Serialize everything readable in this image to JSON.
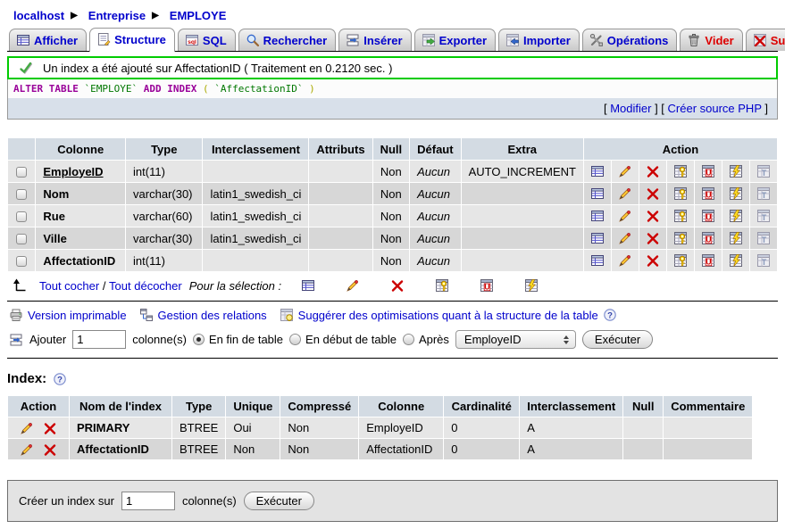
{
  "colors": {
    "link": "#0000CC",
    "danger": "#DD0000",
    "success_border": "#00CC00",
    "header_bg": "#D3DBE3",
    "row_odd": "#E6E6E6",
    "row_even": "#D7D7D7"
  },
  "breadcrumb": {
    "separator": "▶",
    "items": [
      {
        "label": "localhost",
        "icon": "server-icon"
      },
      {
        "label": "Entreprise",
        "icon": "database-icon"
      },
      {
        "label": "EMPLOYE",
        "icon": "table-icon"
      }
    ]
  },
  "tabs": [
    {
      "label": "Afficher",
      "icon": "browse",
      "active": false,
      "danger": false
    },
    {
      "label": "Structure",
      "icon": "structure",
      "active": true,
      "danger": false
    },
    {
      "label": "SQL",
      "icon": "sql",
      "active": false,
      "danger": false
    },
    {
      "label": "Rechercher",
      "icon": "search",
      "active": false,
      "danger": false
    },
    {
      "label": "Insérer",
      "icon": "insert",
      "active": false,
      "danger": false
    },
    {
      "label": "Exporter",
      "icon": "export",
      "active": false,
      "danger": false
    },
    {
      "label": "Importer",
      "icon": "import",
      "active": false,
      "danger": false
    },
    {
      "label": "Opérations",
      "icon": "operations",
      "active": false,
      "danger": false
    },
    {
      "label": "Vider",
      "icon": "empty",
      "active": false,
      "danger": true
    },
    {
      "label": "Supprimer",
      "icon": "drop-table",
      "active": false,
      "danger": true
    }
  ],
  "message": {
    "text": "Un index a été ajouté sur AffectationID ( Traitement en 0.2120 sec. )"
  },
  "sql": {
    "tokens": [
      {
        "t": "ALTER TABLE ",
        "c": "kw"
      },
      {
        "t": "`EMPLOYE`",
        "c": "id"
      },
      {
        "t": " ADD INDEX ",
        "c": "kw"
      },
      {
        "t": "( ",
        "c": "pu"
      },
      {
        "t": "`AffectationID`",
        "c": "id"
      },
      {
        "t": " )",
        "c": "pu"
      }
    ],
    "links": [
      "Modifier",
      "Créer source PHP"
    ],
    "bracket_open": "[",
    "bracket_close": "]"
  },
  "structure_table": {
    "headers": [
      "Colonne",
      "Type",
      "Interclassement",
      "Attributs",
      "Null",
      "Défaut",
      "Extra",
      "Action"
    ],
    "action_icons": [
      "browse",
      "change",
      "drop",
      "primary",
      "unique",
      "index",
      "fulltext"
    ],
    "rows": [
      {
        "name": "EmployeID",
        "primary": true,
        "type": "int(11)",
        "collation": "",
        "attributes": "",
        "null": "Non",
        "default": "Aucun",
        "extra": "AUTO_INCREMENT"
      },
      {
        "name": "Nom",
        "primary": false,
        "type": "varchar(30)",
        "collation": "latin1_swedish_ci",
        "attributes": "",
        "null": "Non",
        "default": "Aucun",
        "extra": ""
      },
      {
        "name": "Rue",
        "primary": false,
        "type": "varchar(60)",
        "collation": "latin1_swedish_ci",
        "attributes": "",
        "null": "Non",
        "default": "Aucun",
        "extra": ""
      },
      {
        "name": "Ville",
        "primary": false,
        "type": "varchar(30)",
        "collation": "latin1_swedish_ci",
        "attributes": "",
        "null": "Non",
        "default": "Aucun",
        "extra": ""
      },
      {
        "name": "AffectationID",
        "primary": false,
        "type": "int(11)",
        "collation": "",
        "attributes": "",
        "null": "Non",
        "default": "Aucun",
        "extra": ""
      }
    ]
  },
  "selection": {
    "check_all": "Tout cocher",
    "separator": "/",
    "uncheck_all": "Tout décocher",
    "label": "Pour la sélection :",
    "icons": [
      "browse",
      "change",
      "drop",
      "primary",
      "unique",
      "index"
    ]
  },
  "links_row": [
    {
      "label": "Version imprimable",
      "icon": "printer",
      "help": false
    },
    {
      "label": "Gestion des relations",
      "icon": "relations",
      "help": false
    },
    {
      "label": "Suggérer des optimisations quant à la structure de la table",
      "icon": "propose",
      "help": true
    }
  ],
  "add_column": {
    "label": "Ajouter",
    "value": "1",
    "suffix": "colonne(s)",
    "radios": [
      {
        "label": "En fin de table",
        "selected": true
      },
      {
        "label": "En début de table",
        "selected": false
      },
      {
        "label": "Après",
        "selected": false
      }
    ],
    "select_value": "EmployeID",
    "button": "Exécuter"
  },
  "index_section": {
    "title": "Index:",
    "headers": [
      "Action",
      "Nom de l'index",
      "Type",
      "Unique",
      "Compressé",
      "Colonne",
      "Cardinalité",
      "Interclassement",
      "Null",
      "Commentaire"
    ],
    "action_icons": [
      "change",
      "drop"
    ],
    "rows": [
      {
        "name": "PRIMARY",
        "type": "BTREE",
        "unique": "Oui",
        "packed": "Non",
        "column": "EmployeID",
        "cardinality": "0",
        "collation": "A",
        "null": "",
        "comment": ""
      },
      {
        "name": "AffectationID",
        "type": "BTREE",
        "unique": "Non",
        "packed": "Non",
        "column": "AffectationID",
        "cardinality": "0",
        "collation": "A",
        "null": "",
        "comment": ""
      }
    ]
  },
  "create_index": {
    "label": "Créer un index sur",
    "value": "1",
    "suffix": "colonne(s)",
    "button": "Exécuter"
  }
}
